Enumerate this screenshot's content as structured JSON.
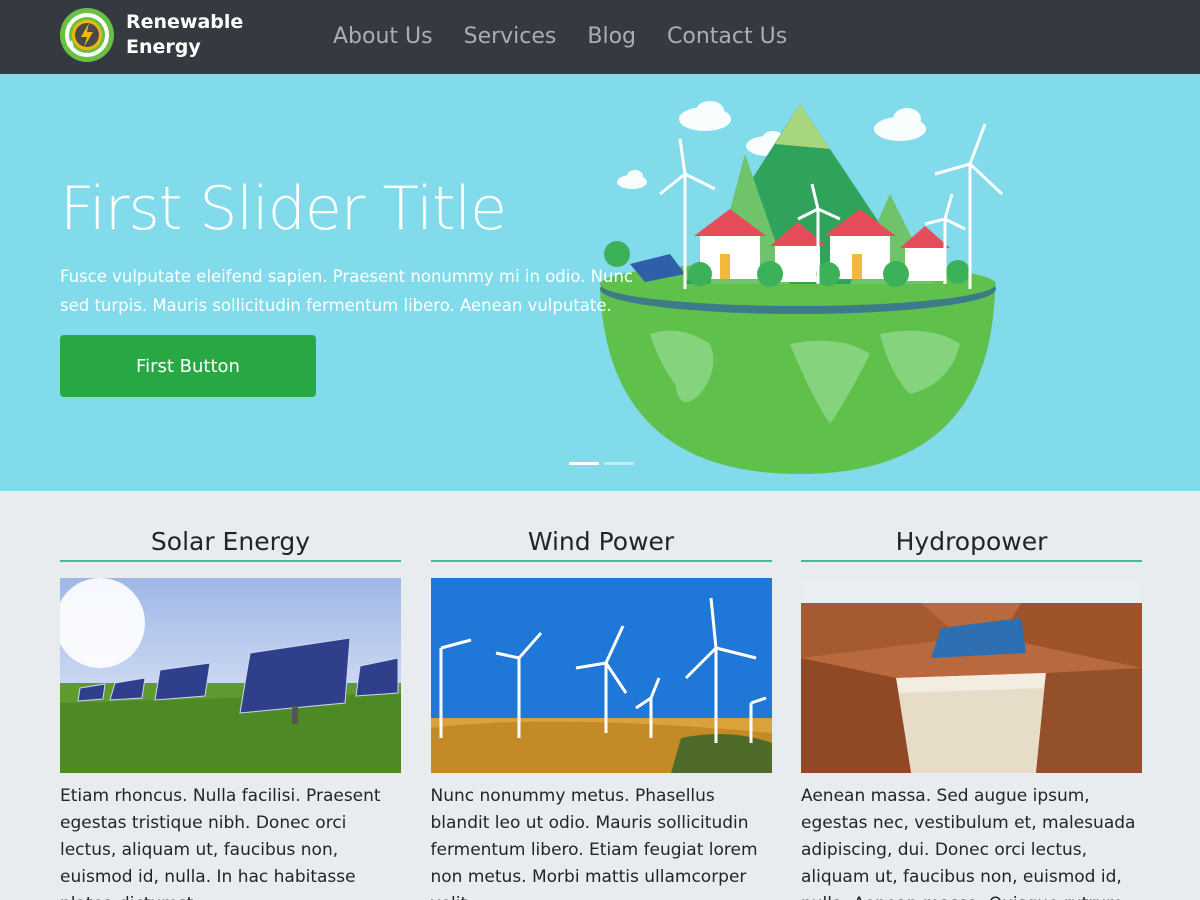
{
  "brand": {
    "name_line1": "Renewable",
    "name_line2": "Energy"
  },
  "nav": {
    "items": [
      {
        "label": "About Us"
      },
      {
        "label": "Services"
      },
      {
        "label": "Blog"
      },
      {
        "label": "Contact Us"
      }
    ]
  },
  "hero": {
    "title": "First Slider Title",
    "text": "Fusce vulputate eleifend sapien. Praesent nonummy mi in odio. Nunc sed turpis. Mauris sollicitudin fermentum libero. Aenean vulputate.",
    "button_label": "First Button",
    "slides_count": 2,
    "active_slide": 1
  },
  "features": [
    {
      "title": "Solar Energy",
      "text": "Etiam rhoncus. Nulla facilisi. Praesent egestas tristique nibh. Donec orci lectus, aliquam ut, faucibus non, euismod id, nulla. In hac habitasse platea dictumst."
    },
    {
      "title": "Wind Power",
      "text": "Nunc nonummy metus. Phasellus blandit leo ut odio. Mauris sollicitudin fermentum libero. Etiam feugiat lorem non metus. Morbi mattis ullamcorper velit."
    },
    {
      "title": "Hydropower",
      "text": "Aenean massa. Sed augue ipsum, egestas nec, vestibulum et, malesuada adipiscing, dui. Donec orci lectus, aliquam ut, faucibus non, euismod id, nulla. Aenean massa. Quisque rutrum."
    }
  ],
  "colors": {
    "header_bg": "#343a40",
    "hero_bg": "#81dbeb",
    "accent_green": "#28a745",
    "page_bg": "#e9ecef",
    "title_underline": "#3fbf96"
  }
}
